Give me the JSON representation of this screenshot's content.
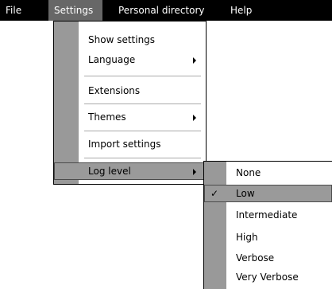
{
  "menubar": {
    "items": [
      "File",
      "Settings",
      "Personal directory",
      "Help"
    ],
    "active": "Settings"
  },
  "settings_menu": {
    "show_settings": "Show settings",
    "language": "Language",
    "extensions": "Extensions",
    "themes": "Themes",
    "import_settings": "Import settings",
    "log_level": "Log level"
  },
  "log_level_menu": {
    "items": [
      "None",
      "Low",
      "Intermediate",
      "High",
      "Verbose",
      "Very Verbose"
    ],
    "checked": "Low"
  },
  "icons": {
    "submenu_arrow": "chevron-right-icon",
    "check": "checkmark-icon"
  },
  "colors": {
    "menubar_bg": "#000000",
    "active_bg": "#676767",
    "gutter": "#999999",
    "highlight": "#9a9a9a"
  }
}
